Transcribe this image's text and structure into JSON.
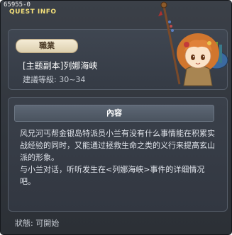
{
  "window": {
    "quest_id": "65955-0",
    "header": "QUEST INFO"
  },
  "quest": {
    "job_tag": "職業",
    "title": "[主题副本]列娜海峡",
    "level": "建議等級: 30~34"
  },
  "content": {
    "header": "內容",
    "text": "风兄河丐帮金银岛特派员小兰有没有什么事情能在积累实战经验的同时，又能通过拯救生命之类的义行来提高玄山派的形象。\n与小兰对话，听听发生在<列娜海峡>事件的详细情况吧。"
  },
  "status": {
    "label": "狀態: 可開始"
  }
}
